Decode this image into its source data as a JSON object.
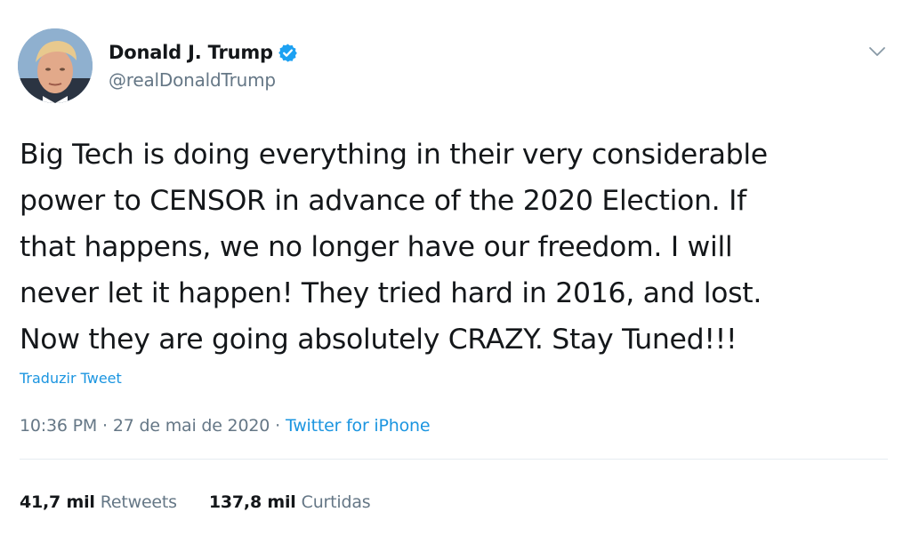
{
  "user": {
    "display_name": "Donald J. Trump",
    "handle": "@realDonaldTrump",
    "verified": true,
    "verified_icon": "verified-badge-icon",
    "avatar_icon": "profile-avatar"
  },
  "header": {
    "menu_icon": "chevron-down-icon"
  },
  "tweet": {
    "lines": [
      "Big Tech is doing everything in their very considerable",
      "power to CENSOR in advance of the 2020 Election. If",
      "that happens, we no longer have our freedom. I will",
      "never let it happen! They tried hard in 2016, and lost.",
      "Now they are going absolutely CRAZY. Stay Tuned!!!"
    ],
    "translate_label": "Traduzir Tweet"
  },
  "meta": {
    "time": "10:36 PM",
    "separator": "·",
    "date": "27 de mai de 2020",
    "source": "Twitter for iPhone"
  },
  "stats": {
    "retweets_count": "41,7 mil",
    "retweets_label": "Retweets",
    "likes_count": "137,8 mil",
    "likes_label": "Curtidas"
  },
  "colors": {
    "link": "#1b95e0",
    "text": "#14171a",
    "secondary": "#657786",
    "divider": "#e6ecf0"
  }
}
